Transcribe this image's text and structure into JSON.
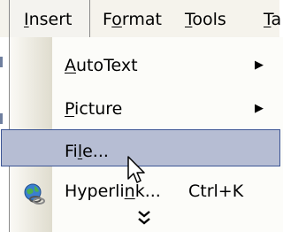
{
  "menubar": {
    "items": [
      {
        "label": "Insert",
        "pre": "",
        "mnemonic": "I",
        "post": "nsert"
      },
      {
        "label": "Format",
        "pre": "F",
        "mnemonic": "o",
        "post": "rmat"
      },
      {
        "label": "Tools",
        "pre": "",
        "mnemonic": "T",
        "post": "ools"
      },
      {
        "label": "Ta",
        "pre": "",
        "mnemonic": "T",
        "post": "a"
      }
    ]
  },
  "dropdown": {
    "items": [
      {
        "label": "AutoText",
        "pre": "",
        "mnemonic": "A",
        "post": "utoText",
        "submenu": true
      },
      {
        "label": "Picture",
        "pre": "",
        "mnemonic": "P",
        "post": "icture",
        "submenu": true
      },
      {
        "label": "File...",
        "pre": "Fi",
        "mnemonic": "l",
        "post": "e...",
        "highlighted": true
      },
      {
        "label": "Hyperlink...",
        "pre": "Hyperli",
        "mnemonic": "n",
        "post": "k...",
        "shortcut": "Ctrl+K",
        "icon": "globe-link-icon"
      }
    ],
    "expand_icon": "double-chevron-down-icon"
  },
  "icons": {
    "submenu_arrow": "▶",
    "expand": "double-chevron-down-icon",
    "hyperlink": "globe-link-icon",
    "cursor": "mouse-pointer-icon"
  },
  "colors": {
    "highlight_fill": "#b6bdd3",
    "highlight_border": "#3c5595",
    "menubar_bg": "#f5f3ec",
    "gutter_end": "#dfdcce"
  }
}
